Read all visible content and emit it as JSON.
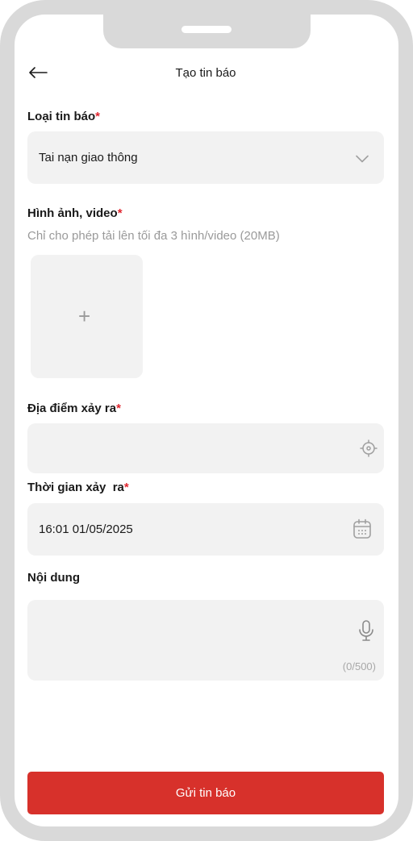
{
  "header": {
    "title": "Tạo tin báo",
    "back_icon": "arrow-left-icon"
  },
  "report_type": {
    "label": "Loại tin báo",
    "required_mark": "*",
    "value": "Tai nạn giao thông",
    "icon": "chevron-down-icon"
  },
  "media": {
    "label": "Hình ảnh, video",
    "required_mark": "*",
    "hint": "Chỉ cho phép tải lên tối đa 3 hình/video (20MB)",
    "add_symbol": "+"
  },
  "location": {
    "label": "Địa điểm xảy ra",
    "required_mark": "*",
    "value": "",
    "icon": "locate-crosshair-icon"
  },
  "time": {
    "label": "Thời gian xảy  ra",
    "required_mark": "*",
    "value": "16:01 01/05/2025",
    "icon": "calendar-icon"
  },
  "content": {
    "label": "Nội dung",
    "value": "",
    "counter": "(0/500)",
    "icon": "microphone-icon"
  },
  "submit": {
    "label": "Gửi tin báo"
  },
  "colors": {
    "accent": "#d7312b",
    "required": "#e0262f",
    "field_bg": "#f2f2f2",
    "frame": "#d9d9d9"
  }
}
